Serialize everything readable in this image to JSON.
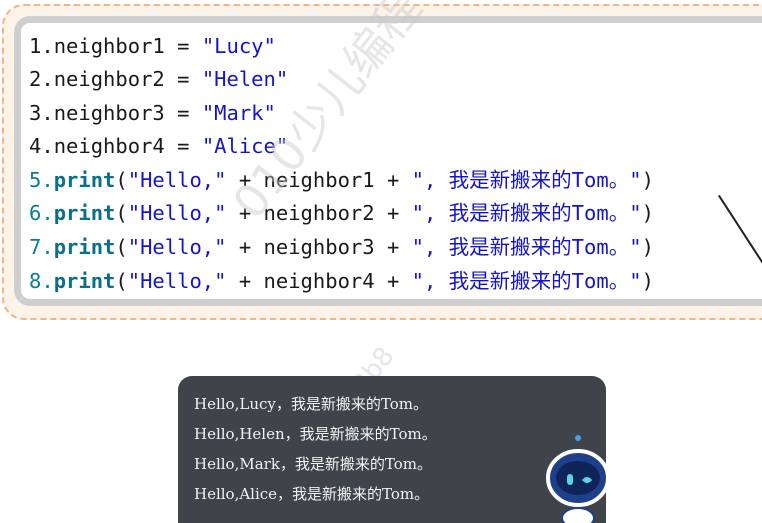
{
  "code": {
    "lines": [
      {
        "num": "1.",
        "var": "neighbor1",
        "eq": " = ",
        "value": "\"Lucy\""
      },
      {
        "num": "2.",
        "var": "neighbor2",
        "eq": " = ",
        "value": "\"Helen\""
      },
      {
        "num": "3.",
        "var": "neighbor3",
        "eq": " = ",
        "value": "\"Mark\""
      },
      {
        "num": "4.",
        "var": "neighbor4",
        "eq": " = ",
        "value": "\"Alice\""
      }
    ],
    "prints": [
      {
        "num": "5.",
        "kw": "print",
        "open": "(",
        "s1": "\"Hello,\"",
        "plus1": " + ",
        "var": "neighbor1",
        "plus2": " + ",
        "s2": "\", 我是新搬来的Tom。\"",
        "close": ")"
      },
      {
        "num": "6.",
        "kw": "print",
        "open": "(",
        "s1": "\"Hello,\"",
        "plus1": " + ",
        "var": "neighbor2",
        "plus2": " + ",
        "s2": "\", 我是新搬来的Tom。\"",
        "close": ")"
      },
      {
        "num": "7.",
        "kw": "print",
        "open": "(",
        "s1": "\"Hello,\"",
        "plus1": " + ",
        "var": "neighbor3",
        "plus2": " + ",
        "s2": "\", 我是新搬来的Tom。\"",
        "close": ")"
      },
      {
        "num": "8.",
        "kw": "print",
        "open": "(",
        "s1": "\"Hello,\"",
        "plus1": " + ",
        "var": "neighbor4",
        "plus2": " + ",
        "s2": "\", 我是新搬来的Tom。\"",
        "close": ")"
      }
    ]
  },
  "console": {
    "lines": [
      "Hello,Lucy，我是新搬来的Tom。",
      "Hello,Helen，我是新搬来的Tom。",
      "Hello,Mark，我是新搬来的Tom。",
      "Hello,Alice，我是新搬来的Tom。"
    ]
  },
  "watermark": {
    "text": "010少儿编程",
    "sub": "f17893b8"
  },
  "colors": {
    "card_border": "#f3b585",
    "card_bg": "#fdf3e9",
    "console_bg": "#3f434a",
    "robot_body": "#1e3f8a",
    "robot_eye": "#5ad6e0"
  },
  "icons": {
    "robot": "robot-mascot-icon"
  }
}
